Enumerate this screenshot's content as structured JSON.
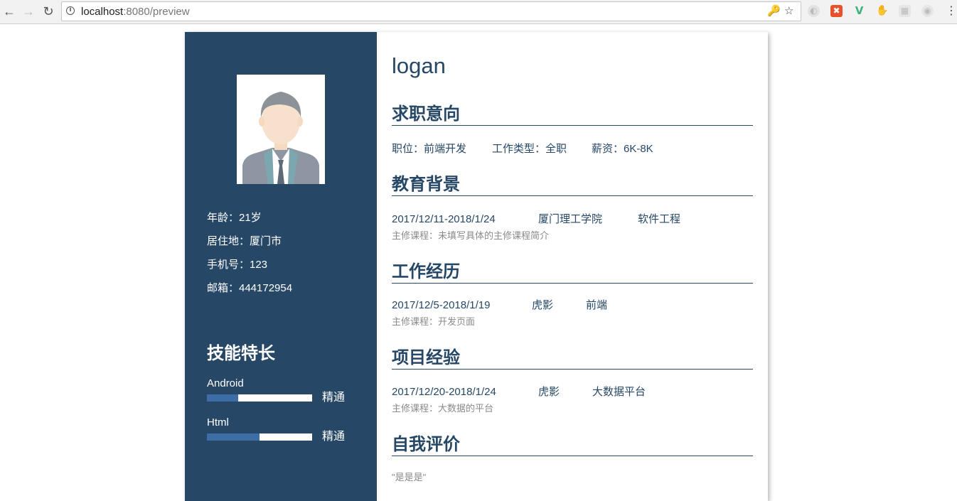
{
  "browser": {
    "url_host": "localhost",
    "url_rest": ":8080/preview",
    "icons": [
      "back-icon",
      "forward-icon",
      "reload-icon",
      "info-icon",
      "key-icon",
      "star-icon",
      "menu-icon"
    ]
  },
  "colors": {
    "sidebar": "#264766",
    "heading": "#264766",
    "skill_fill": "#3c6ea5",
    "subtext": "#8a8a8a"
  },
  "sidebar": {
    "info": {
      "age": "年龄：21岁",
      "residence": "居住地：厦门市",
      "phone": "手机号：123",
      "email": "邮箱：444172954"
    },
    "skills_title": "技能特长",
    "skills": [
      {
        "name": "Android",
        "level": "精通",
        "progress": 0.3
      },
      {
        "name": "Html",
        "level": "精通",
        "progress": 0.5
      }
    ]
  },
  "main": {
    "name": "logan",
    "job_intention": {
      "title": "求职意向",
      "position": "职位：前端开发",
      "type": "工作类型：全职",
      "salary": "薪资：6K-8K"
    },
    "education": {
      "title": "教育背景",
      "date": "2017/12/11-2018/1/24",
      "school": "厦门理工学院",
      "major": "软件工程",
      "detail": "主修课程：未填写具体的主修课程简介"
    },
    "work": {
      "title": "工作经历",
      "date": "2017/12/5-2018/1/19",
      "company": "虎影",
      "role": "前端",
      "detail": "主修课程：开发页面"
    },
    "project": {
      "title": "项目经验",
      "date": "2017/12/20-2018/1/24",
      "company": "虎影",
      "name": "大数据平台",
      "detail": "主修课程：大数据的平台"
    },
    "self_evaluation": {
      "title": "自我评价",
      "text": "\"是是是\""
    }
  }
}
